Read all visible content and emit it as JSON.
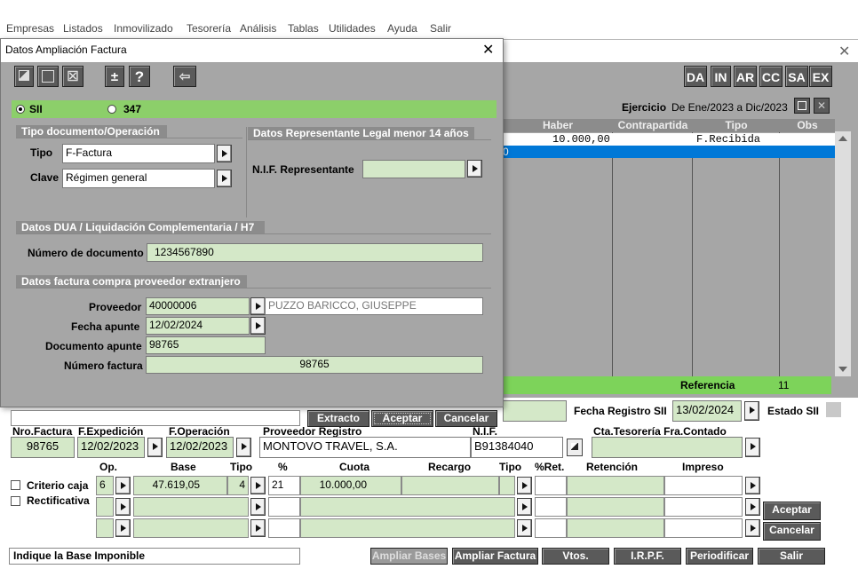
{
  "menu": [
    "Empresas",
    "Listados",
    "Inmovilizado",
    "Tesorería",
    "Análisis",
    "Tablas",
    "Utilidades",
    "Ayuda",
    "Salir"
  ],
  "toolbar_right": [
    "DA",
    "IN",
    "AR",
    "CC",
    "SA",
    "EX"
  ],
  "ejercicio": {
    "label": "Ejercicio",
    "value": "De Ene/2023 a Dic/2023"
  },
  "grid": {
    "headers": [
      "Haber",
      "Contrapartida",
      "Tipo",
      "Obs"
    ],
    "row1": {
      "haber": "10.000,00",
      "tipo": "F.Recibida"
    },
    "row2_frag": "0"
  },
  "referencia": {
    "label": "Referencia",
    "value": "11"
  },
  "registro": {
    "fecha_label": "Fecha Registro SII",
    "fecha": "13/02/2024",
    "estado_label": "Estado SII"
  },
  "factura": {
    "h_nro": "Nro.Factura",
    "h_fexp": "F.Expedición",
    "h_fop": "F.Operación",
    "h_prov": "Proveedor Registro",
    "h_nif": "N.I.F.",
    "h_cta": "Cta.Tesorería Fra.Contado",
    "nro": "98765",
    "fexp": "12/02/2023",
    "fop": "12/02/2023",
    "prov": "MONTOVO TRAVEL, S.A.",
    "nif": "B91384040"
  },
  "iva": {
    "headers": [
      "Op.",
      "Base",
      "Tipo",
      "%",
      "Cuota",
      "Recargo",
      "Tipo",
      "%Ret.",
      "Retención",
      "Impreso"
    ],
    "row": {
      "op": "6",
      "base": "47.619,05",
      "tipo": "4",
      "pct": "21",
      "cuota": "10.000,00"
    }
  },
  "checks": {
    "criterio": "Criterio caja",
    "rectificativa": "Rectificativa"
  },
  "side_buttons": {
    "aceptar": "Aceptar",
    "cancelar": "Cancelar"
  },
  "status": "Indique la Base Imponible",
  "bottom_buttons": [
    "Ampliar Bases",
    "Ampliar Factura",
    "Vtos.",
    "I.R.P.F.",
    "Periodificar",
    "Salir"
  ],
  "dialog": {
    "title": "Datos Ampliación Factura",
    "radio_sii": "SII",
    "radio_347": "347",
    "sec_tipo": "Tipo documento/Operación",
    "tipo_label": "Tipo",
    "tipo": "F-Factura",
    "clave_label": "Clave",
    "clave": "Régimen general",
    "sec_repr": "Datos Representante Legal menor 14 años",
    "nif_repr_label": "N.I.F. Representante",
    "sec_dua": "Datos DUA / Liquidación Complementaria / H7",
    "numdoc_label": "Número de documento",
    "numdoc": "1234567890",
    "sec_ext": "Datos factura compra proveedor extranjero",
    "prov_label": "Proveedor",
    "prov_code": "40000006",
    "prov_name": "PUZZO BARICCO, GIUSEPPE",
    "fapunte_label": "Fecha apunte",
    "fapunte": "12/02/2024",
    "docapunte_label": "Documento apunte",
    "docapunte": "98765",
    "numfac_label": "Número factura",
    "numfac": "98765",
    "btn_extracto": "Extracto",
    "btn_aceptar": "Aceptar",
    "btn_cancelar": "Cancelar"
  }
}
